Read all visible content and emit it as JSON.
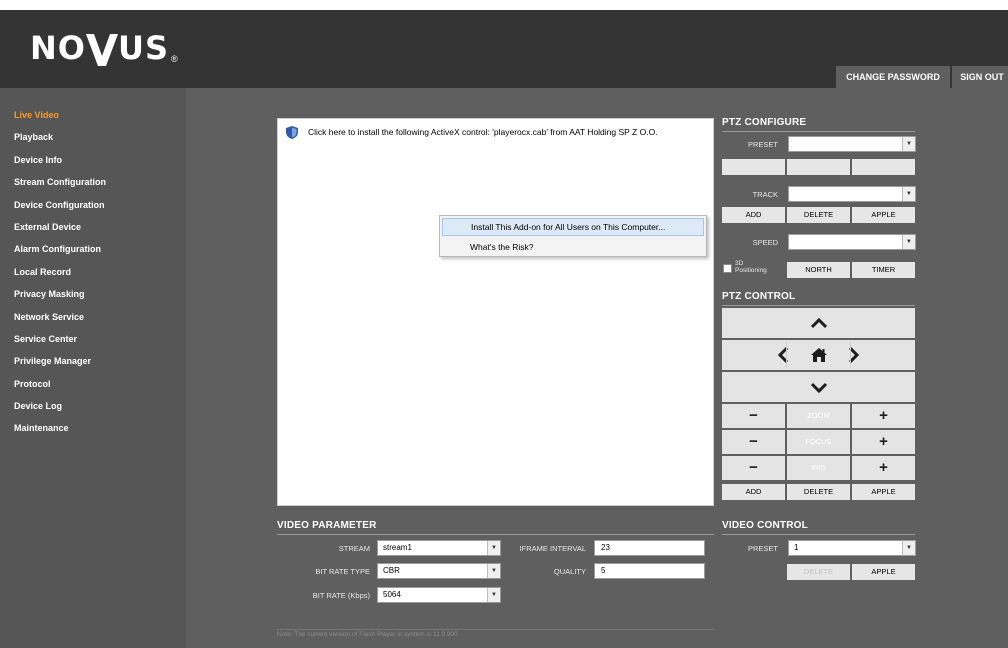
{
  "logo": {
    "text_left": "NO",
    "text_right": "US",
    "registered": "®"
  },
  "header": {
    "change_password": "CHANGE PASSWORD",
    "sign_out": "SIGN OUT"
  },
  "colors": {
    "active_nav": "#ff9a1f",
    "header_bg": "#343434",
    "sidebar_bg": "#565656",
    "content_bg": "#5f5f5f"
  },
  "sidebar": {
    "items": [
      {
        "label": "Live Video",
        "active": true
      },
      {
        "label": "Playback"
      },
      {
        "label": "Device Info"
      },
      {
        "label": "Stream Configuration"
      },
      {
        "label": "Device Configuration"
      },
      {
        "label": "External Device"
      },
      {
        "label": "Alarm Configuration"
      },
      {
        "label": "Local Record"
      },
      {
        "label": "Privacy Masking"
      },
      {
        "label": "Network Service"
      },
      {
        "label": "Service Center"
      },
      {
        "label": "Privilege Manager"
      },
      {
        "label": "Protocol"
      },
      {
        "label": "Device Log"
      },
      {
        "label": "Maintenance"
      }
    ]
  },
  "video": {
    "activex_message": "Click here to install the following ActiveX control: 'playerocx.cab' from AAT Holding  SP Z O.O.",
    "context_menu": [
      "Install This Add-on for All Users on This Computer...",
      "What's the Risk?"
    ]
  },
  "ptz_configure": {
    "title": "PTZ CONFIGURE",
    "preset_label": "PRESET",
    "track_label": "TRACK",
    "add": "ADD",
    "delete": "DELETE",
    "apple": "APPLE",
    "speed_label": "SPEED",
    "positioning_line1": "3D",
    "positioning_line2": "Positioning",
    "north": "NORTH",
    "timer": "TIMER"
  },
  "ptz_control": {
    "title": "PTZ CONTROL",
    "zoom": "ZOOM",
    "focus": "FOCUS",
    "iris": "IRIS",
    "minus": "−",
    "plus": "+",
    "add": "ADD",
    "delete": "DELETE",
    "apple": "APPLE"
  },
  "video_parameter": {
    "title": "VIDEO PARAMETER",
    "stream_label": "STREAM",
    "stream_value": "stream1",
    "bitrate_type_label": "BIT RATE TYPE",
    "bitrate_type_value": "CBR",
    "bitrate_label": "BIT RATE (Kbps)",
    "bitrate_value": "5064",
    "iframe_label": "IFRAME INTERVAL",
    "iframe_value": "23",
    "quality_label": "QUALITY",
    "quality_value": "5"
  },
  "video_control": {
    "title": "VIDEO CONTROL",
    "preset_label": "PRESET",
    "preset_value": "1",
    "delete": "DELETE",
    "apple": "APPLE"
  },
  "note": "Note: The current version of Flash Player in system is 11.9.900"
}
